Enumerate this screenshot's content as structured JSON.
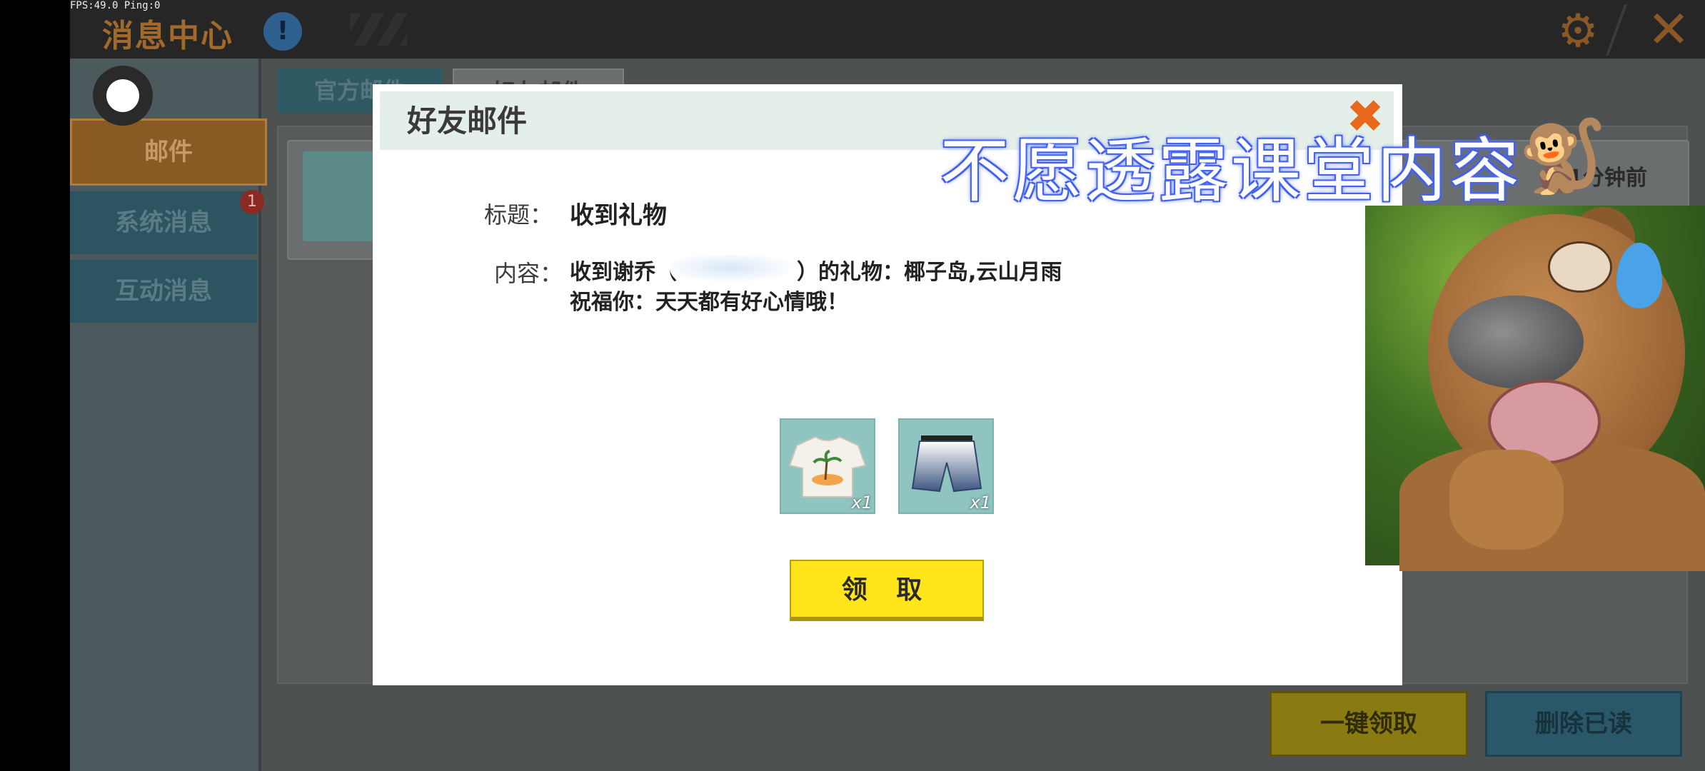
{
  "status": {
    "fps": "FPS:49.0  Ping:0"
  },
  "header": {
    "title": "消息中心",
    "info_icon": "!"
  },
  "sidebar": {
    "items": [
      {
        "label": "邮件"
      },
      {
        "label": "系统消息",
        "badge": "1"
      },
      {
        "label": "互动消息"
      }
    ]
  },
  "tabs": [
    {
      "label": "官方邮件"
    },
    {
      "label": "好友邮件"
    }
  ],
  "list": {
    "time": "1分钟前"
  },
  "actions": {
    "claim_all": "一键领取",
    "delete_read": "删除已读"
  },
  "modal": {
    "title": "好友邮件",
    "subject_label": "标题：",
    "subject": "收到礼物",
    "content_label": "内容：",
    "content_prefix": "收到谢乔（",
    "content_suffix": "）的礼物：椰子岛,云山月雨",
    "content_line2": "祝福你：天天都有好心情哦！",
    "items": [
      {
        "name": "shirt",
        "qty": "x1"
      },
      {
        "name": "shorts",
        "qty": "x1"
      }
    ],
    "claim_button": "领 取"
  },
  "overlay": {
    "text": "不愿透露课堂内容"
  },
  "icons": {
    "info": "info-icon",
    "gear": "gear-icon",
    "close": "close-icon",
    "modal_close": "close-icon",
    "monkey": "monkey-icon"
  },
  "colors": {
    "accent_orange": "#e8691c",
    "claim_yellow": "#ffe51a",
    "sidebar_teal": "#2d5561"
  }
}
